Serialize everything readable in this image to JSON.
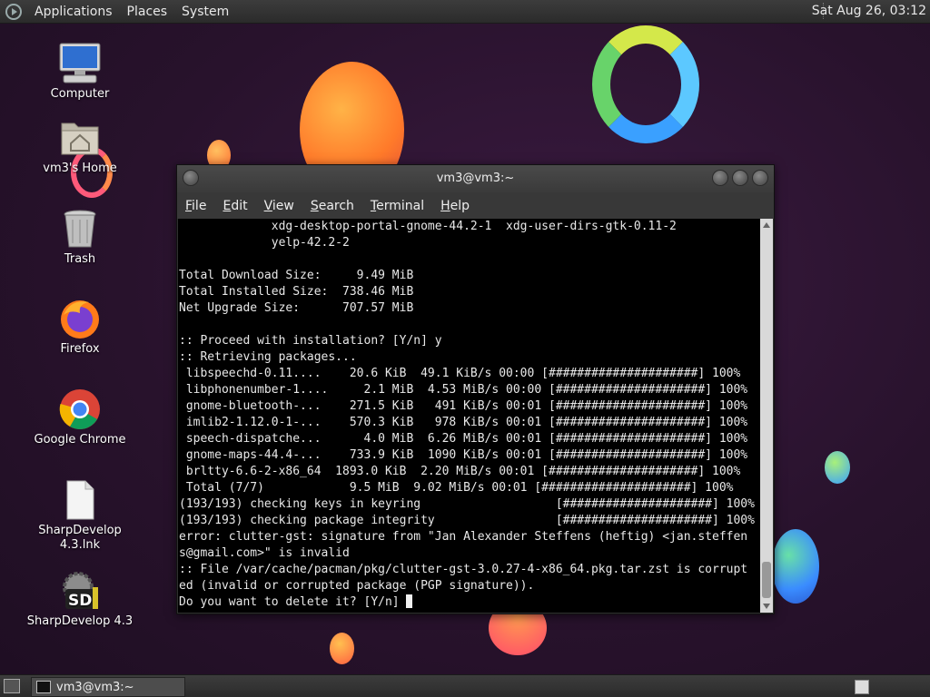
{
  "top_panel": {
    "menus": [
      "Applications",
      "Places",
      "System"
    ],
    "clock": "Sat Aug 26, 03:12"
  },
  "desktop": {
    "icons": [
      {
        "label": "Computer",
        "icon": "computer-icon"
      },
      {
        "label": "vm3's Home",
        "icon": "home-folder-icon"
      },
      {
        "label": "Trash",
        "icon": "trash-icon"
      },
      {
        "label": "Firefox",
        "icon": "firefox-icon"
      },
      {
        "label": "Google Chrome",
        "icon": "chrome-icon"
      },
      {
        "label": "SharpDevelop 4.3.lnk",
        "icon": "file-icon"
      },
      {
        "label": "SharpDevelop 4.3",
        "icon": "sharpdevelop-icon"
      }
    ]
  },
  "terminal": {
    "title": "vm3@vm3:~",
    "menu": [
      {
        "accel": "F",
        "rest": "ile"
      },
      {
        "accel": "E",
        "rest": "dit"
      },
      {
        "accel": "V",
        "rest": "iew"
      },
      {
        "accel": "S",
        "rest": "earch"
      },
      {
        "accel": "T",
        "rest": "erminal"
      },
      {
        "accel": "H",
        "rest": "elp"
      }
    ],
    "output": "             xdg-desktop-portal-gnome-44.2-1  xdg-user-dirs-gtk-0.11-2\n             yelp-42.2-2\n\nTotal Download Size:     9.49 MiB\nTotal Installed Size:  738.46 MiB\nNet Upgrade Size:      707.57 MiB\n\n:: Proceed with installation? [Y/n] y\n:: Retrieving packages...\n libspeechd-0.11....    20.6 KiB  49.1 KiB/s 00:00 [#####################] 100%\n libphonenumber-1....     2.1 MiB  4.53 MiB/s 00:00 [#####################] 100%\n gnome-bluetooth-...    271.5 KiB   491 KiB/s 00:01 [#####################] 100%\n imlib2-1.12.0-1-...    570.3 KiB   978 KiB/s 00:01 [#####################] 100%\n speech-dispatche...      4.0 MiB  6.26 MiB/s 00:01 [#####################] 100%\n gnome-maps-44.4-...    733.9 KiB  1090 KiB/s 00:01 [#####################] 100%\n brltty-6.6-2-x86_64  1893.0 KiB  2.20 MiB/s 00:01 [#####################] 100%\n Total (7/7)            9.5 MiB  9.02 MiB/s 00:01 [#####################] 100%\n(193/193) checking keys in keyring                   [#####################] 100%\n(193/193) checking package integrity                 [#####################] 100%\nerror: clutter-gst: signature from \"Jan Alexander Steffens (heftig) <jan.steffen\ns@gmail.com>\" is invalid\n:: File /var/cache/pacman/pkg/clutter-gst-3.0.27-4-x86_64.pkg.tar.zst is corrupt\ned (invalid or corrupted package (PGP signature)).\nDo you want to delete it? [Y/n] "
  },
  "taskbar": {
    "window_button": "vm3@vm3:~"
  }
}
